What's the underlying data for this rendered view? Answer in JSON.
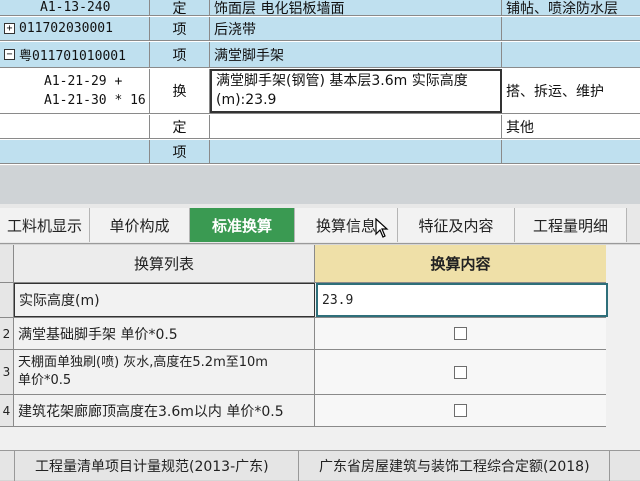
{
  "top_grid": {
    "rows": [
      {
        "code": "A1-13-240",
        "type": "定",
        "name": "饰面层 电化铝板墙面",
        "spec": "铺帖、喷涂防水层"
      },
      {
        "code": "011702030001",
        "type": "项",
        "name": "后浇带",
        "spec": ""
      },
      {
        "code": "粤011701010001",
        "type": "项",
        "name": "满堂脚手架",
        "spec": ""
      },
      {
        "code_line1": "A1-21-29 +",
        "code_line2": "A1-21-30 * 16",
        "type": "换",
        "name": "满堂脚手架(钢管) 基本层3.6m  实际高度(m):23.9",
        "spec": "搭、拆运、维护"
      },
      {
        "code": "",
        "type": "定",
        "name": "",
        "spec": "其他"
      },
      {
        "code": "",
        "type": "项",
        "name": "",
        "spec": ""
      }
    ],
    "tree_expand": "+",
    "tree_collapse": "−"
  },
  "tabs": [
    {
      "label": "工料机显示"
    },
    {
      "label": "单价构成"
    },
    {
      "label": "标准换算"
    },
    {
      "label": "换算信息"
    },
    {
      "label": "特征及内容"
    },
    {
      "label": "工程量明细"
    }
  ],
  "panel": {
    "header_left": "换算列表",
    "header_right": "换算内容",
    "rows": [
      {
        "label": "实际高度(m)",
        "value": "23.9"
      },
      {
        "num": "2",
        "label": "满堂基础脚手架 单价*0.5"
      },
      {
        "num": "3",
        "label_line1": "天棚面单独刷(喷) 灰水,高度在5.2m至10m",
        "label_line2": "单价*0.5"
      },
      {
        "num": "4",
        "label": "建筑花架廊廊顶高度在3.6m以内 单价*0.5"
      }
    ]
  },
  "status": {
    "left": "工程量清单项目计量规范(2013-广东)",
    "right": "广东省房屋建筑与装饰工程综合定额(2018)"
  }
}
